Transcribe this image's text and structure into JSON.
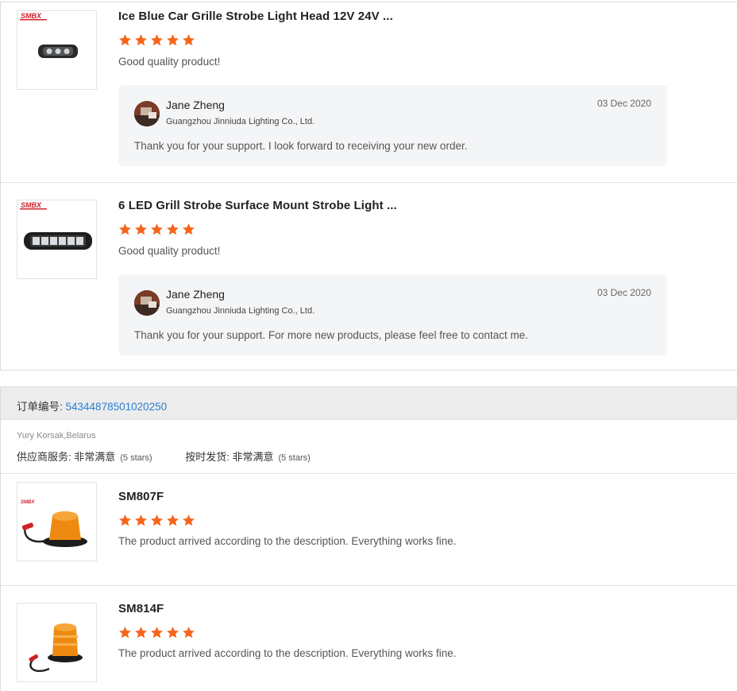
{
  "order1": {
    "items": [
      {
        "logo": "SMBX",
        "product_name": "Ice Blue Car Grille Strobe Light Head 12V 24V ...",
        "rating": 5,
        "review": "Good quality product!",
        "reply": {
          "name": "Jane Zheng",
          "company": "Guangzhou Jinniuda Lighting Co., Ltd.",
          "date": "03 Dec 2020",
          "text": "Thank you for your support. I look forward to receiving your new order."
        }
      },
      {
        "logo": "SMBX",
        "product_name": "6 LED Grill Strobe Surface Mount Strobe Light ...",
        "rating": 5,
        "review": "Good quality product!",
        "reply": {
          "name": "Jane Zheng",
          "company": "Guangzhou Jinniuda Lighting Co., Ltd.",
          "date": "03 Dec 2020",
          "text": "Thank you for your support. For more new products, please feel free to contact me."
        }
      }
    ]
  },
  "order2": {
    "order_label": "订单编号: ",
    "order_number": "54344878501020250",
    "buyer": "Yury Korsak,Belarus",
    "supplier_service_label": "供应商服务: ",
    "supplier_service_value": "非常满意",
    "supplier_service_stars": "(5 stars)",
    "on_time_label": "按时发货: ",
    "on_time_value": "非常满意",
    "on_time_stars": "(5 stars)",
    "items": [
      {
        "logo": "SMBX",
        "product_name": "SM807F",
        "rating": 5,
        "review": "The product arrived according to the description. Everything works fine."
      },
      {
        "product_name": "SM814F",
        "rating": 5,
        "review": "The product arrived according to the description. Everything works fine."
      }
    ]
  },
  "colors": {
    "star": "#f5651a",
    "link": "#2b7fd0",
    "reply_bg": "#f4f5f7",
    "order_header_bg": "#ececec"
  }
}
